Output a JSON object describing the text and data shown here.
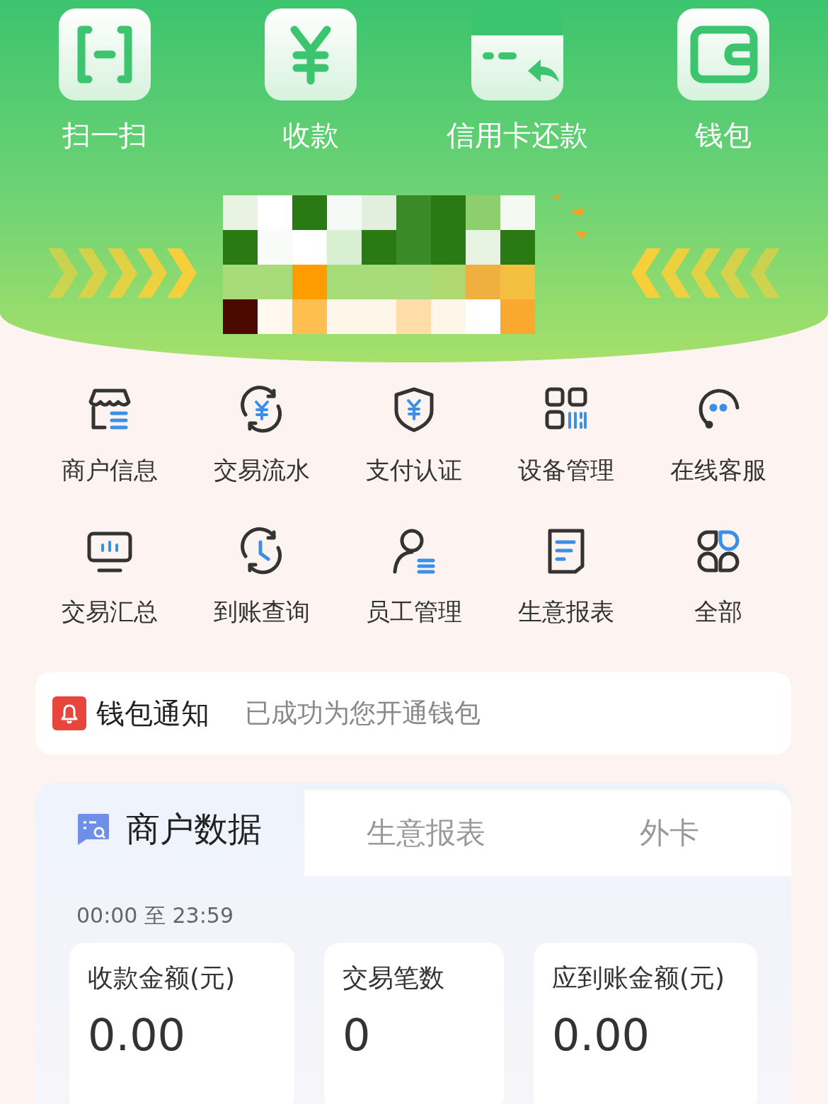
{
  "top_actions": [
    {
      "label": "扫一扫"
    },
    {
      "label": "收款"
    },
    {
      "label": "信用卡还款"
    },
    {
      "label": "钱包"
    }
  ],
  "services": [
    {
      "label": "商户信息"
    },
    {
      "label": "交易流水"
    },
    {
      "label": "支付认证"
    },
    {
      "label": "设备管理"
    },
    {
      "label": "在线客服"
    },
    {
      "label": "交易汇总"
    },
    {
      "label": "到账查询"
    },
    {
      "label": "员工管理"
    },
    {
      "label": "生意报表"
    },
    {
      "label": "全部"
    }
  ],
  "notice": {
    "title": "钱包通知",
    "message": "已成功为您开通钱包"
  },
  "data_tabs": [
    {
      "label": "商户数据",
      "selected": true
    },
    {
      "label": "生意报表",
      "selected": false
    },
    {
      "label": "外卡",
      "selected": false
    }
  ],
  "time_range": "00:00 至  23:59",
  "stats": [
    {
      "label": "收款金额(元)",
      "value": "0.00"
    },
    {
      "label": "交易笔数",
      "value": "0"
    },
    {
      "label": "应到账金额(元)",
      "value": "0.00"
    }
  ]
}
